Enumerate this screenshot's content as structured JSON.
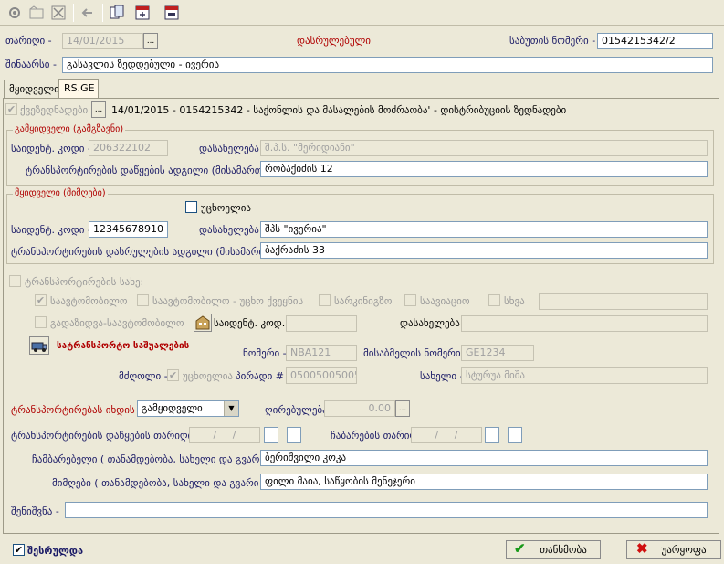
{
  "header": {
    "date_label": "თარიღი -",
    "date_value": "14/01/2015",
    "dots": "...",
    "status_text": "დასრულებული",
    "doc_number_label": "საბუთის ნომერი -",
    "doc_number_value": "0154215342/2",
    "note_label": "შინაარსი -",
    "note_value": "გასავლის ზედდებული - ივერია"
  },
  "tabs": [
    {
      "label": "მყიდველი"
    },
    {
      "label": "RS.GE"
    }
  ],
  "rsge": {
    "waybill_checkbox": "ქვეზედნადები",
    "waybill_text": "'14/01/2015 - 0154215342 - საქონლის და მასალების მოძრაობა' - დისტრიბუციის ზედნადები",
    "seller": {
      "title": "გამყიდველი (გამგზავნი)",
      "tax_label": "საიდენტ. კოდი -",
      "tax_value": "206322102",
      "name_label": "დასახელება -",
      "name_value": "შ.პ.ს. \"მერიდიანი\"",
      "address_label": "ტრანსპორტირების დაწყების ადგილი (მისამართი) -",
      "address_value": "რობაქიძის 12"
    },
    "buyer": {
      "title": "მყიდველი (მიმღები)",
      "foreign_label": "უცხოელია",
      "tax_label": "საიდენტ. კოდი -",
      "tax_value": "12345678910",
      "name_label": "დასახელება -",
      "name_value": "შპს \"ივერია\"",
      "address_label": "ტრანსპორტირების დასრულების ადგილი (მისამართი) -",
      "address_value": "ბაქრაძის 33"
    },
    "transport": {
      "type_label": "ტრანსპორტირების სახე:",
      "opt_auto": "საავტომობილო",
      "opt_auto_foreign": "საავტომობილო - უცხო ქვეყნის",
      "opt_rail": "სარკინიგზო",
      "opt_air": "საავიაციო",
      "opt_other": "სხვა",
      "opt_trailer": "გადაზიდვა-საავტომობილო",
      "trailer_tax_label": "საიდენტ. კოდ...",
      "trailer_name_label": "დასახელება -",
      "vehicle_title": "სატრანსპორტო საშუალების",
      "number_label": "ნომერი -",
      "number_value": "NBA121",
      "trailer_number_label": "მისაბმელის ნომერი -",
      "trailer_number_value": "GE1234",
      "driver_label": "მძღოლი -",
      "driver_foreign": "უცხოელია",
      "personal_no_label": "პირადი # -",
      "personal_no_value": "05005005005",
      "driver_name_label": "სახელი -",
      "driver_name_value": "სტურუა მიშა"
    },
    "cost_payer_label": "ტრანსპორტირებას იხდის -",
    "cost_payer_value": "გამყიდველი",
    "cost_label": "ღირებულება -",
    "cost_value": "0.00",
    "start_date_label": "ტრანსპორტირების დაწყების თარიღი -",
    "start_date_value": "/ /",
    "delivery_date_label": "ჩაბარების თარიღი -",
    "delivery_date_value": "/ /",
    "handed_label": "ჩამბარებელი ( თანამდებობა, სახელი და გვარი ) -",
    "handed_value": "ბერიშვილი კოკა",
    "received_label": "მიმღები ( თანამდებობა, სახელი და გვარი ) -",
    "received_value": "ფილი მაია, საწყობის მენეჯერი",
    "remark_label": "შენიშვნა -",
    "remark_value": ""
  },
  "footer": {
    "done_label": "შესრულდა",
    "ok_label": "თანხმობა",
    "cancel_label": "უარყოფა"
  },
  "colors": {
    "background": "#ece9d8",
    "accent_red": "#b00000",
    "label_navy": "#1a1a66",
    "field_border": "#7f9db9"
  }
}
